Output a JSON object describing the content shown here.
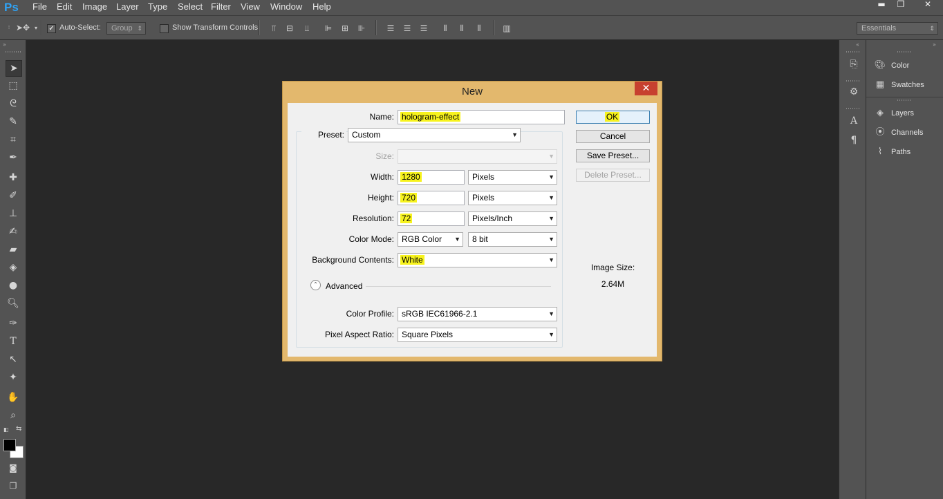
{
  "app": {
    "logo": "Ps"
  },
  "menu": [
    "File",
    "Edit",
    "Image",
    "Layer",
    "Type",
    "Select",
    "Filter",
    "View",
    "Window",
    "Help"
  ],
  "window_controls": {
    "minimize": "▬",
    "restore": "❐",
    "close": "✕"
  },
  "options_bar": {
    "auto_select_label": "Auto-Select:",
    "auto_select_checked": true,
    "group_select": "Group",
    "show_transform_label": "Show Transform Controls",
    "show_transform_checked": false,
    "workspace": "Essentials"
  },
  "panels": {
    "items": [
      "Color",
      "Swatches",
      "Layers",
      "Channels",
      "Paths"
    ]
  },
  "dialog": {
    "title": "New",
    "close": "✕",
    "name_label": "Name:",
    "name_value": "hologram-effect",
    "preset_label": "Preset:",
    "preset_value": "Custom",
    "size_label": "Size:",
    "size_value": "",
    "width_label": "Width:",
    "width_value": "1280",
    "width_unit": "Pixels",
    "height_label": "Height:",
    "height_value": "720",
    "height_unit": "Pixels",
    "resolution_label": "Resolution:",
    "resolution_value": "72",
    "resolution_unit": "Pixels/Inch",
    "color_mode_label": "Color Mode:",
    "color_mode_value": "RGB Color",
    "bit_depth": "8 bit",
    "background_label": "Background Contents:",
    "background_value": "White",
    "advanced_label": "Advanced",
    "color_profile_label": "Color Profile:",
    "color_profile_value": "sRGB IEC61966-2.1",
    "pixel_aspect_label": "Pixel Aspect Ratio:",
    "pixel_aspect_value": "Square Pixels",
    "ok": "OK",
    "cancel": "Cancel",
    "save_preset": "Save Preset...",
    "delete_preset": "Delete Preset...",
    "image_size_label": "Image Size:",
    "image_size_value": "2.64M"
  },
  "colors": {
    "highlight": "#f7f31e",
    "dialog_frame": "#e3b86d",
    "close_red": "#c7402f",
    "ui_gray": "#535353",
    "canvas": "#282828"
  }
}
